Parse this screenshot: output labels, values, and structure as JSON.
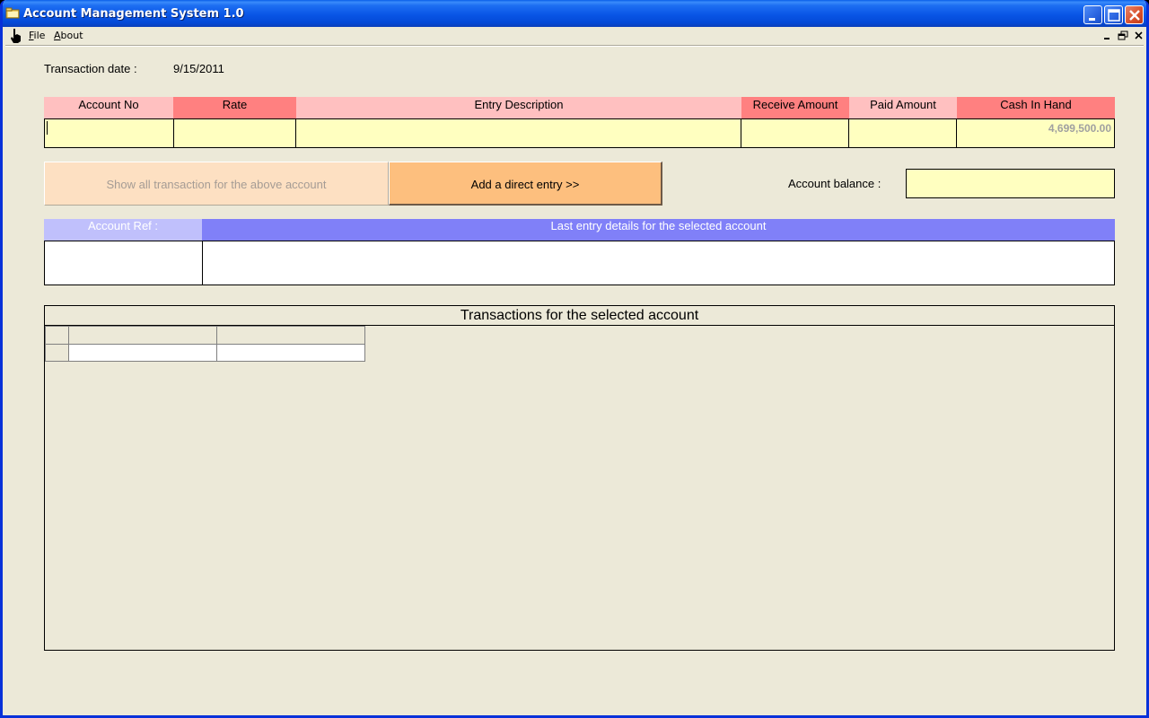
{
  "window": {
    "title": "Account Management System 1.0"
  },
  "menu": {
    "items": [
      {
        "label": "File",
        "accel": "F",
        "rest": "ile"
      },
      {
        "label": "About",
        "accel": "A",
        "rest": "bout"
      }
    ]
  },
  "transaction": {
    "date_label": "Transaction date :",
    "date_value": "9/15/2011"
  },
  "entry_table": {
    "headers": [
      "Account No",
      "Rate",
      "Entry Description",
      "Receive Amount",
      "Paid Amount",
      "Cash In Hand"
    ],
    "header_colors": [
      "#ffc0c0",
      "#ff8080",
      "#ffc0c0",
      "#ff8080",
      "#ffc0c0",
      "#ff8080"
    ],
    "cash_in_hand": "4,699,500.00"
  },
  "buttons": {
    "show_all": "Show all transaction for the above account",
    "add_entry": "Add a direct entry >>"
  },
  "balance": {
    "label": "Account balance :"
  },
  "details": {
    "ref_label": "Account Ref :",
    "last_entry_label": "Last entry details for the selected account"
  },
  "transactions": {
    "title": "Transactions for the selected account"
  }
}
